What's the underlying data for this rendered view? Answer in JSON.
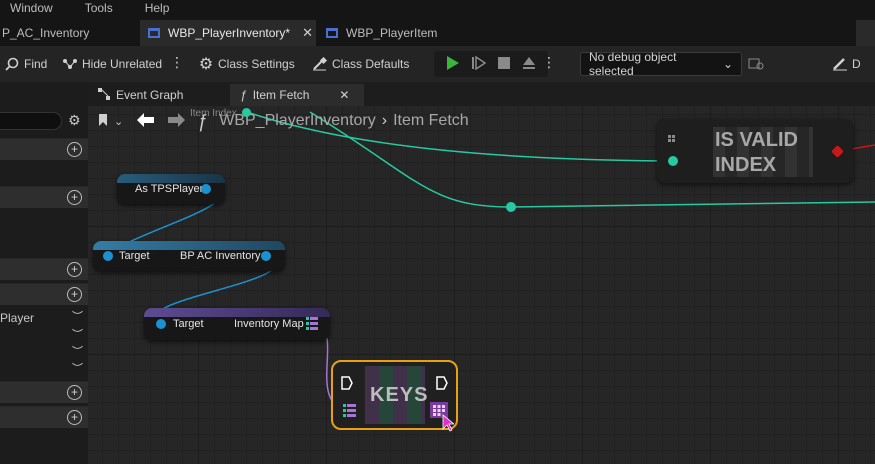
{
  "menubar": {
    "items": [
      "Window",
      "Tools",
      "Help"
    ]
  },
  "tabs": [
    {
      "label": "P_AC_Inventory",
      "active": false
    },
    {
      "label": "WBP_PlayerInventory*",
      "active": true
    },
    {
      "label": "WBP_PlayerItem",
      "active": false
    }
  ],
  "toolbar": {
    "find_label": "Find",
    "hide_unrelated_label": "Hide Unrelated",
    "class_settings_label": "Class Settings",
    "class_defaults_label": "Class Defaults",
    "debug_select_value": "No debug object selected",
    "truncated_label": "D"
  },
  "graph_tabs": [
    {
      "label": "Event Graph",
      "icon": "graph-icon",
      "active": false
    },
    {
      "label": "Item Fetch",
      "icon": "function-icon",
      "active": true
    }
  ],
  "breadcrumb": {
    "root": "WBP_PlayerInventory",
    "separator": "›",
    "current": "Item Fetch",
    "fn_glyph": "ƒ"
  },
  "left_panel": {
    "player_text": "Player",
    "gear": "⚙"
  },
  "nodes": {
    "as_tps": {
      "label": "As TPSPlayer"
    },
    "bp_ac": {
      "target_label": "Target",
      "output_label": "BP AC Inventory"
    },
    "inv_map": {
      "target_label": "Target",
      "output_label": "Inventory Map"
    },
    "keys": {
      "title": "KEYS"
    },
    "is_valid": {
      "title_line1": "IS VALID",
      "title_line2": "INDEX"
    },
    "item_index_label": "Item Index"
  },
  "colors": {
    "accent_play": "#38b63d",
    "wire_teal": "#27c9a0",
    "wire_blue": "#1b92d0",
    "wire_purple": "#a574d6",
    "selection_orange": "#e8a117",
    "tab_blueprint_icon": "#4a6fcf"
  }
}
